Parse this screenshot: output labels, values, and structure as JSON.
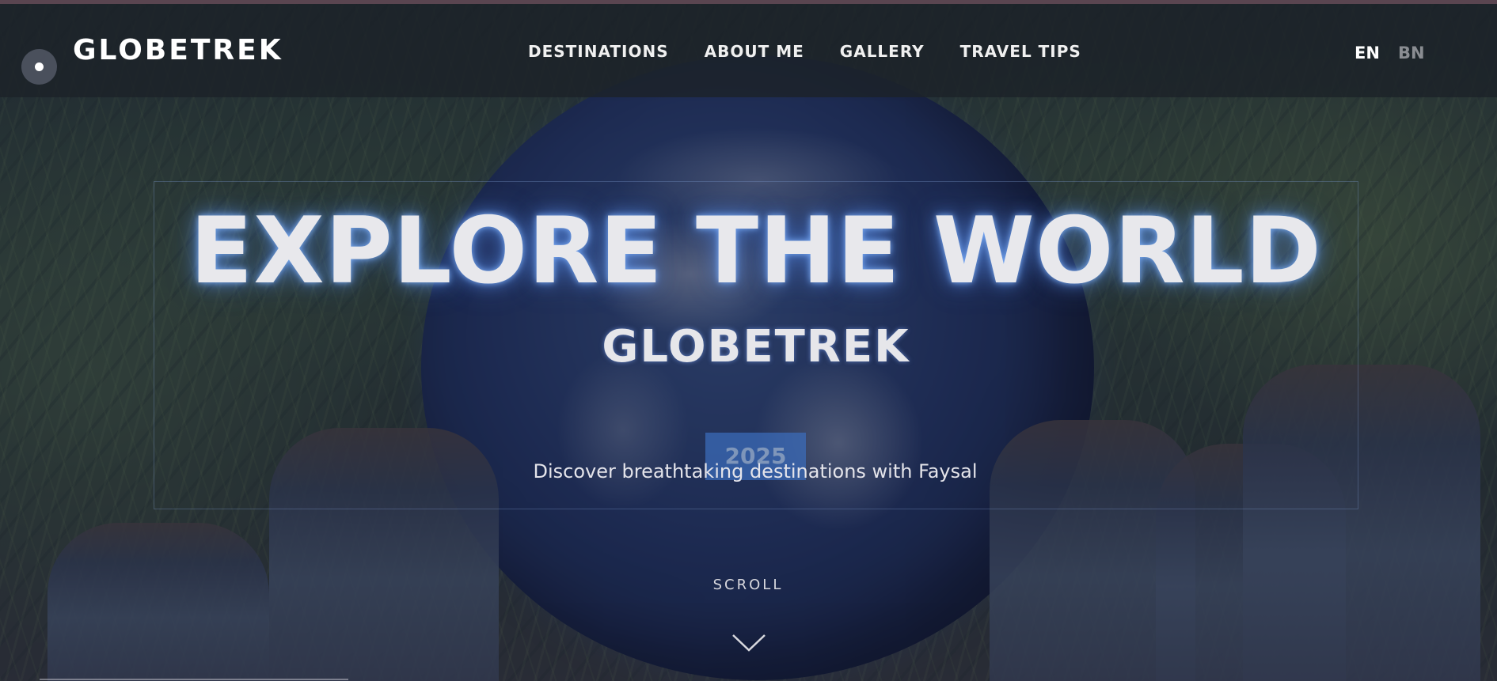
{
  "header": {
    "brand": "GLOBETREK",
    "nav": [
      {
        "label": "DESTINATIONS"
      },
      {
        "label": "ABOUT ME"
      },
      {
        "label": "GALLERY"
      },
      {
        "label": "TRAVEL TIPS"
      }
    ],
    "languages": [
      {
        "label": "EN",
        "active": true
      },
      {
        "label": "BN",
        "active": false
      }
    ]
  },
  "hero": {
    "title": "EXPLORE THE WORLD",
    "subtitle": "GLOBETREK",
    "year": "2025",
    "tagline": "Discover breathtaking destinations with Faysal",
    "scroll_label": "SCROLL",
    "scroll_icon": "chevron-down-icon"
  },
  "colors": {
    "nav_bg": "#1c2228",
    "text": "#ffffff",
    "inactive_lang": "#8a8d92",
    "glow": "#64a0ff",
    "year_badge": "#3c6ebe"
  }
}
